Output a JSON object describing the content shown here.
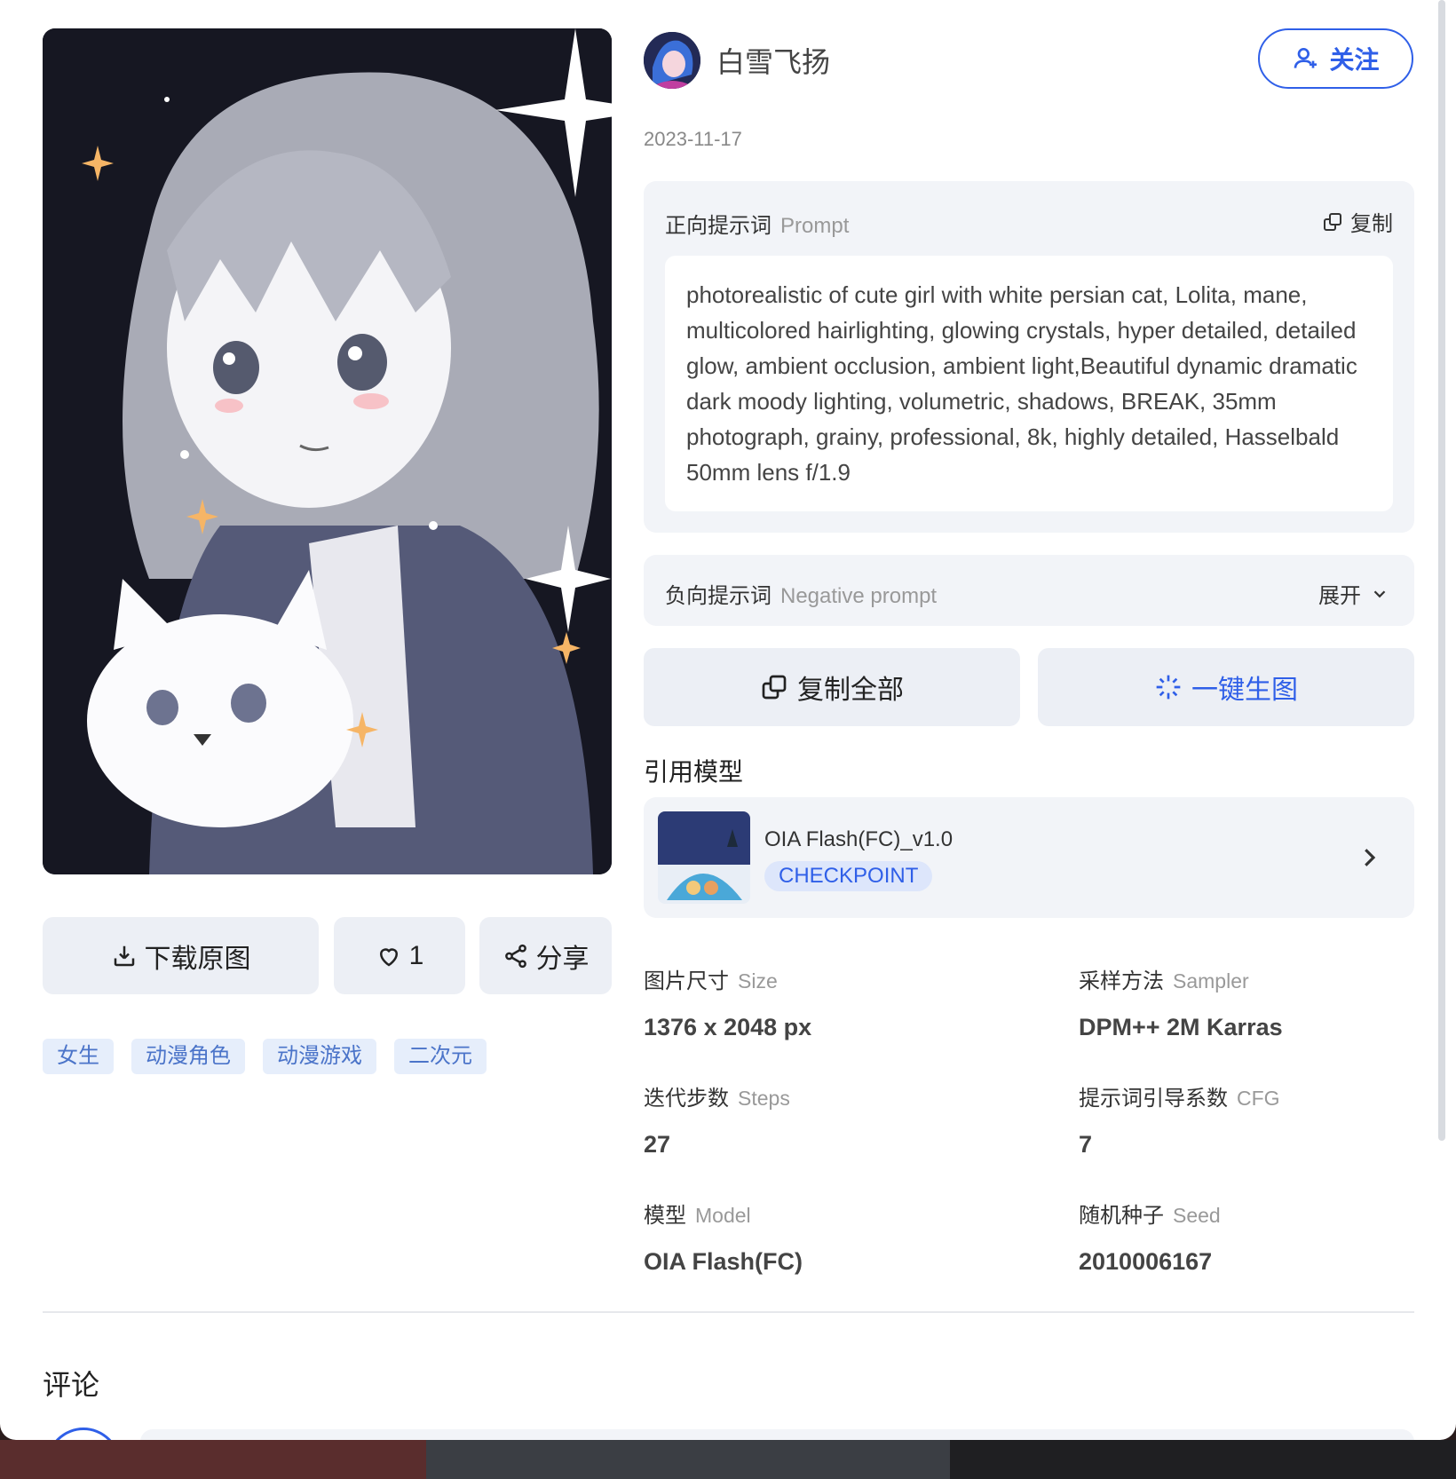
{
  "author": {
    "name": "白雪飞扬",
    "follow_label": "关注"
  },
  "date": "2023-11-17",
  "prompt": {
    "label": "正向提示词",
    "label_en": "Prompt",
    "copy_label": "复制",
    "text": "photorealistic of cute girl with white persian cat, Lolita, mane, multicolored hairlighting, glowing crystals, hyper detailed, detailed glow, ambient occlusion, ambient light,Beautiful dynamic dramatic dark moody lighting, volumetric, shadows, BREAK, 35mm photograph, grainy, professional, 8k, highly detailed, Hasselbald 50mm lens f/1.9"
  },
  "negative": {
    "label": "负向提示词",
    "label_en": "Negative prompt",
    "expand_label": "展开"
  },
  "buttons": {
    "copy_all": "复制全部",
    "generate": "一键生图"
  },
  "left_actions": {
    "download": "下载原图",
    "likes": "1",
    "share": "分享"
  },
  "tags": [
    "女生",
    "动漫角色",
    "动漫游戏",
    "二次元"
  ],
  "model_section": {
    "title": "引用模型",
    "name": "OIA Flash(FC)_v1.0",
    "badge": "CHECKPOINT"
  },
  "params": {
    "size": {
      "label": "图片尺寸",
      "label_en": "Size",
      "value": "1376 x 2048 px"
    },
    "sampler": {
      "label": "采样方法",
      "label_en": "Sampler",
      "value": "DPM++ 2M Karras"
    },
    "steps": {
      "label": "迭代步数",
      "label_en": "Steps",
      "value": "27"
    },
    "cfg": {
      "label": "提示词引导系数",
      "label_en": "CFG",
      "value": "7"
    },
    "model": {
      "label": "模型",
      "label_en": "Model",
      "value": "OIA Flash(FC)"
    },
    "seed": {
      "label": "随机种子",
      "label_en": "Seed",
      "value": "2010006167"
    }
  },
  "comments": {
    "title": "评论"
  },
  "colors": {
    "accent": "#2f5fe8",
    "panel": "#f2f4f8",
    "button": "#eceff5",
    "tag_bg": "#e6eefb",
    "tag_text": "#4b74c9"
  },
  "icons": [
    "download-icon",
    "heart-icon",
    "share-icon",
    "add-user-icon",
    "copy-icon",
    "chevron-down-icon",
    "sparkle-icon",
    "chevron-right-icon"
  ]
}
